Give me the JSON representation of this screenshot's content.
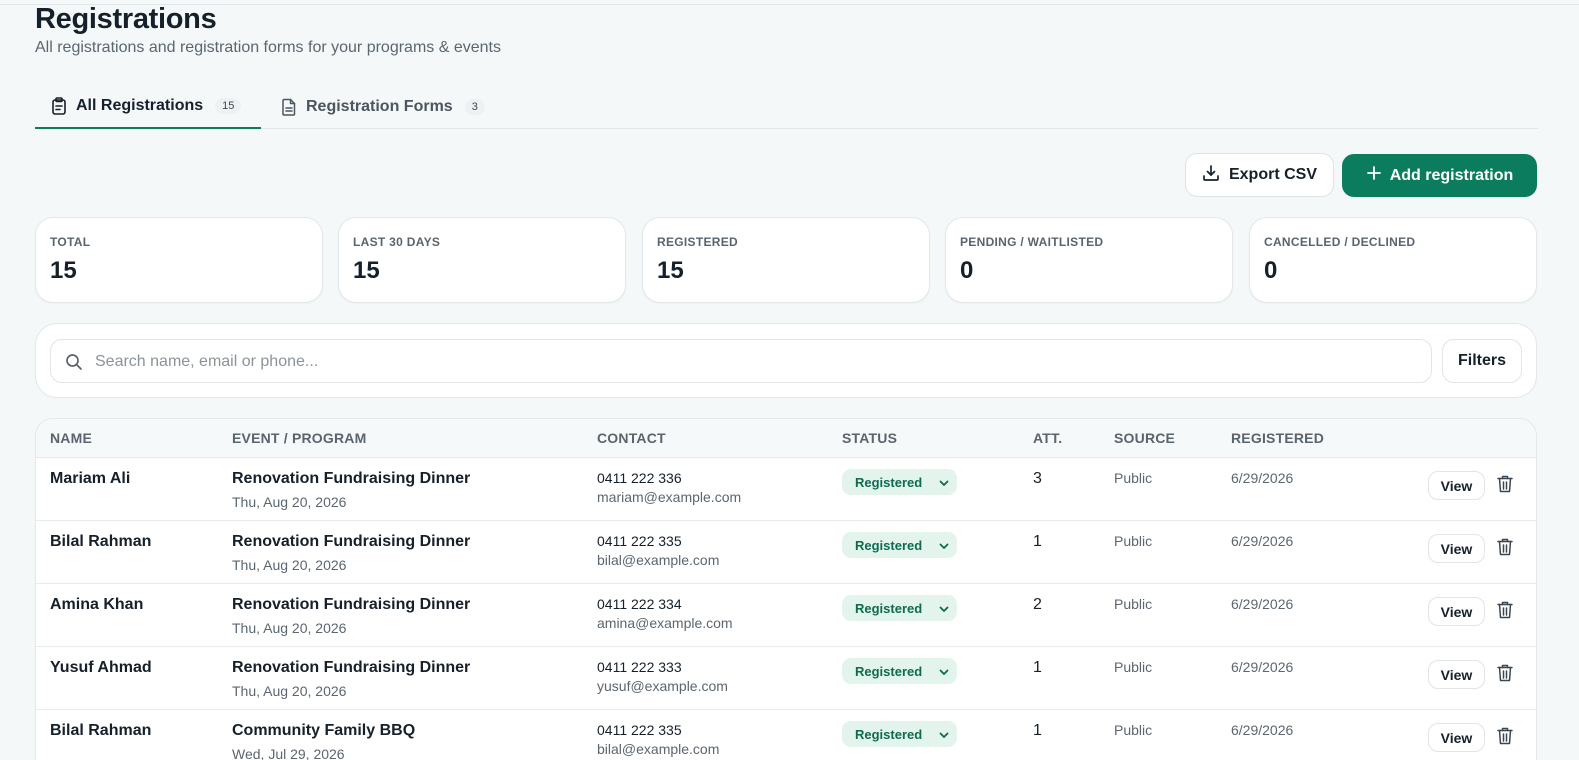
{
  "header": {
    "title": "Registrations",
    "subtitle": "All registrations and registration forms for your programs & events"
  },
  "tabs": [
    {
      "label": "All Registrations",
      "count": "15",
      "icon": "clipboard-icon",
      "active": true
    },
    {
      "label": "Registration Forms",
      "count": "3",
      "icon": "document-icon",
      "active": false
    }
  ],
  "actions": {
    "export_label": "Export CSV",
    "add_label": "Add registration"
  },
  "stats": [
    {
      "label": "TOTAL",
      "value": "15"
    },
    {
      "label": "LAST 30 DAYS",
      "value": "15"
    },
    {
      "label": "REGISTERED",
      "value": "15"
    },
    {
      "label": "PENDING / WAITLISTED",
      "value": "0"
    },
    {
      "label": "CANCELLED / DECLINED",
      "value": "0"
    }
  ],
  "search": {
    "placeholder": "Search name, email or phone...",
    "value": "",
    "filters_label": "Filters"
  },
  "table": {
    "columns": [
      "NAME",
      "EVENT / PROGRAM",
      "CONTACT",
      "STATUS",
      "ATT.",
      "SOURCE",
      "REGISTERED"
    ],
    "view_label": "View",
    "rows": [
      {
        "name": "Mariam Ali",
        "event": "Renovation Fundraising Dinner",
        "date": "Thu, Aug 20, 2026",
        "phone": "0411 222 336",
        "email": "mariam@example.com",
        "status": "Registered",
        "att": "3",
        "source": "Public",
        "registered": "6/29/2026"
      },
      {
        "name": "Bilal Rahman",
        "event": "Renovation Fundraising Dinner",
        "date": "Thu, Aug 20, 2026",
        "phone": "0411 222 335",
        "email": "bilal@example.com",
        "status": "Registered",
        "att": "1",
        "source": "Public",
        "registered": "6/29/2026"
      },
      {
        "name": "Amina Khan",
        "event": "Renovation Fundraising Dinner",
        "date": "Thu, Aug 20, 2026",
        "phone": "0411 222 334",
        "email": "amina@example.com",
        "status": "Registered",
        "att": "2",
        "source": "Public",
        "registered": "6/29/2026"
      },
      {
        "name": "Yusuf Ahmad",
        "event": "Renovation Fundraising Dinner",
        "date": "Thu, Aug 20, 2026",
        "phone": "0411 222 333",
        "email": "yusuf@example.com",
        "status": "Registered",
        "att": "1",
        "source": "Public",
        "registered": "6/29/2026"
      },
      {
        "name": "Bilal Rahman",
        "event": "Community Family BBQ",
        "date": "Wed, Jul 29, 2026",
        "phone": "0411 222 335",
        "email": "bilal@example.com",
        "status": "Registered",
        "att": "1",
        "source": "Public",
        "registered": "6/29/2026"
      }
    ]
  },
  "colors": {
    "accent": "#0b7d5e",
    "status_registered_bg": "#e3f4ed",
    "status_registered_text": "#0e6b50",
    "page_bg": "#f4f8f8"
  }
}
